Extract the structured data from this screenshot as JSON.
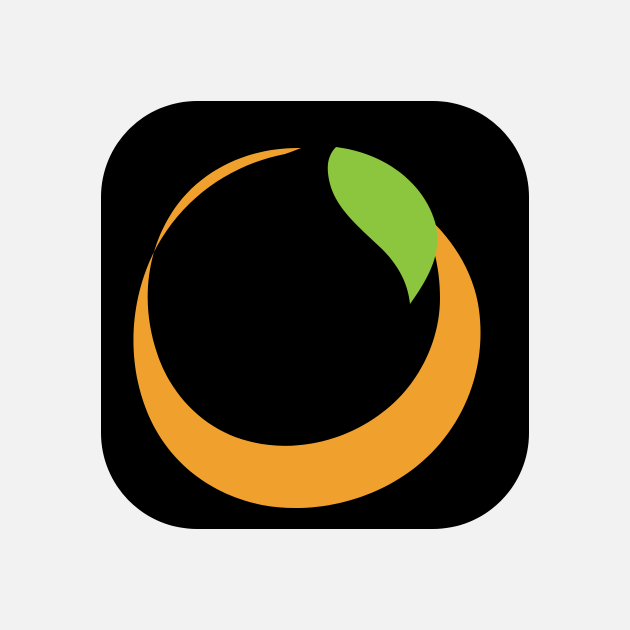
{
  "colors": {
    "page_background": "#f2f2f2",
    "tile_background": "#000000",
    "orange": "#f0a12d",
    "leaf": "#8cc63f"
  },
  "icon": {
    "name": "orange-with-leaf-app-icon"
  }
}
